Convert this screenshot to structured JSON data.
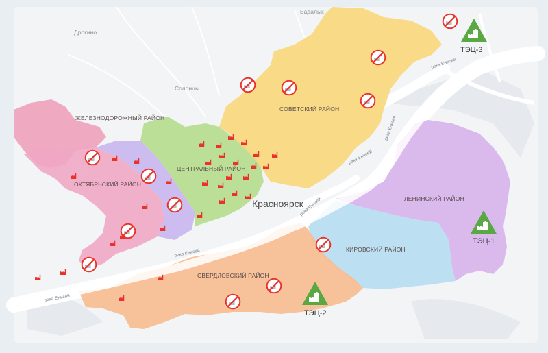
{
  "city": "Красноярск",
  "districts": [
    {
      "id": "zheleznodorozhny",
      "label": "ЖЕЛЕЗНОДОРОЖНЫЙ РАЙОН",
      "color": "#ee9fb9"
    },
    {
      "id": "oktyabrsky",
      "label": "ОКТЯБРЬСКИЙ РАЙОН",
      "color": "#f0a6c3"
    },
    {
      "id": "tsentralny",
      "label": "ЦЕНТРАЛЬНЫЙ РАЙОН",
      "color": "#b7dc8f"
    },
    {
      "id": "sovetsky",
      "label": "СОВЕТСКИЙ РАЙОН",
      "color": "#f8d77d"
    },
    {
      "id": "leninsky",
      "label": "ЛЕНИНСКИЙ РАЙОН",
      "color": "#d8b3ec"
    },
    {
      "id": "kirovsky",
      "label": "КИРОВСКИЙ РАЙОН",
      "color": "#b9ddf1"
    },
    {
      "id": "sverdlovsky",
      "label": "СВЕРДЛОВСКИЙ РАЙОН",
      "color": "#f7bc91"
    }
  ],
  "places": [
    "Бадалык",
    "Дрокино",
    "Солонцы"
  ],
  "river_labels": [
    "река Енисей",
    "река Енисей",
    "река Енисей",
    "река Енисей",
    "река Енисей",
    "река Енисей"
  ],
  "power_plants": [
    {
      "label": "ТЭЦ-1",
      "color": "#5aa843"
    },
    {
      "label": "ТЭЦ-2",
      "color": "#5aa843"
    },
    {
      "label": "ТЭЦ-3",
      "color": "#5aa843"
    }
  ],
  "colors": {
    "background": "#e9eef3",
    "factory": "#e8322b",
    "no_symbol": "#e8322b"
  }
}
